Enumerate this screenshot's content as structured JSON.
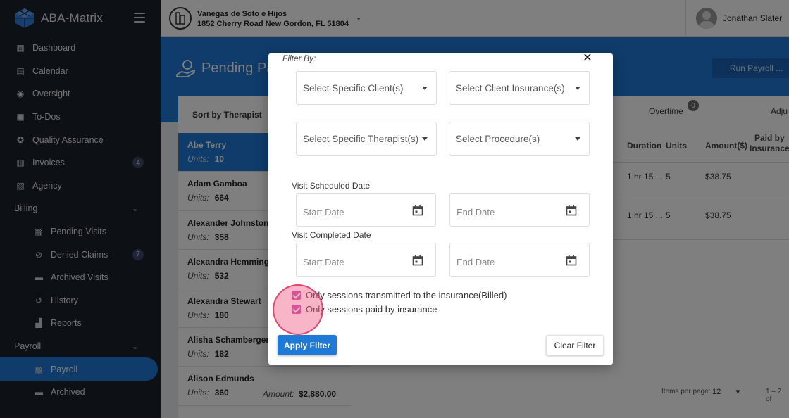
{
  "app": {
    "name": "ABA-Matrix"
  },
  "sidebar": {
    "items": [
      {
        "label": "Dashboard",
        "icon": "dashboard-icon"
      },
      {
        "label": "Calendar",
        "icon": "calendar-icon"
      },
      {
        "label": "Oversight",
        "icon": "eye-icon"
      },
      {
        "label": "To-Dos",
        "icon": "todo-icon"
      },
      {
        "label": "Quality Assurance",
        "icon": "quality-icon"
      },
      {
        "label": "Invoices",
        "icon": "invoice-icon",
        "badge": "4"
      },
      {
        "label": "Agency",
        "icon": "agency-icon"
      },
      {
        "label": "Billing",
        "section": true
      },
      {
        "label": "Pending Visits",
        "icon": "pending-visits-icon"
      },
      {
        "label": "Denied Claims",
        "icon": "denied-icon",
        "badge": "7"
      },
      {
        "label": "Archived Visits",
        "icon": "archive-icon"
      },
      {
        "label": "History",
        "icon": "history-icon"
      },
      {
        "label": "Reports",
        "icon": "reports-icon"
      },
      {
        "label": "Payroll",
        "section": true
      },
      {
        "label": "Payroll",
        "icon": "payroll-icon",
        "active": true
      },
      {
        "label": "Archived",
        "icon": "archive-icon"
      }
    ]
  },
  "topbar": {
    "agency_name": "Vanegas de Soto e Hijos",
    "agency_address": "1852 Cherry Road New Gordon, FL 51804",
    "user_name": "Jonathan Slater"
  },
  "page": {
    "title": "Pending Pa",
    "run_button": "Run Payroll ...",
    "sort_label": "Sort by Therapist",
    "overtime_label": "Overtime",
    "overtime_count": "0",
    "adjust_label": "Adju",
    "columns": {
      "duration": "Duration",
      "units": "Units",
      "amount": "Amount($)",
      "paid_by": "Paid by",
      "insurance": "Insurance"
    },
    "rows": [
      {
        "duration": "1 hr 15 ...",
        "units": "5",
        "amount": "$38.75"
      },
      {
        "duration": "1 hr 15 ...",
        "units": "5",
        "amount": "$38.75"
      }
    ],
    "pager": {
      "label": "Items per page:",
      "value": "12",
      "range": "1 – 2 of"
    }
  },
  "therapists": [
    {
      "name": "Abe Terry",
      "units_label": "Units:",
      "units": "10",
      "selected": true
    },
    {
      "name": "Adam Gamboa",
      "units_label": "Units:",
      "units": "664"
    },
    {
      "name": "Alexander Johnston",
      "units_label": "Units:",
      "units": "358"
    },
    {
      "name": "Alexandra Hemmings",
      "units_label": "Units:",
      "units": "532"
    },
    {
      "name": "Alexandra Stewart",
      "units_label": "Units:",
      "units": "180"
    },
    {
      "name": "Alisha Schamberger",
      "units_label": "Units:",
      "units": "182"
    },
    {
      "name": "Alison Edmunds",
      "units_label": "Units:",
      "units": "360",
      "amount_label": "Amount:",
      "amount": "$2,880.00"
    }
  ],
  "modal": {
    "title": "Filter By:",
    "client_select": "Select Specific Client(s)",
    "insurance_select": "Select Client Insurance(s)",
    "therapist_select": "Select Specific Therapist(s)",
    "procedure_select": "Select Procedure(s)",
    "scheduled_label": "Visit Scheduled Date",
    "completed_label": "Visit Completed Date",
    "start_date": "Start Date",
    "end_date": "End Date",
    "billed_check": "Only sessions transmitted to the insurance(Billed)",
    "paid_check": "Only sessions paid by insurance",
    "apply": "Apply Filter",
    "clear": "Clear Filter"
  },
  "colors": {
    "primary": "#1f79d6",
    "sidebar": "#1b2129",
    "checkbox": "#c052a6"
  }
}
